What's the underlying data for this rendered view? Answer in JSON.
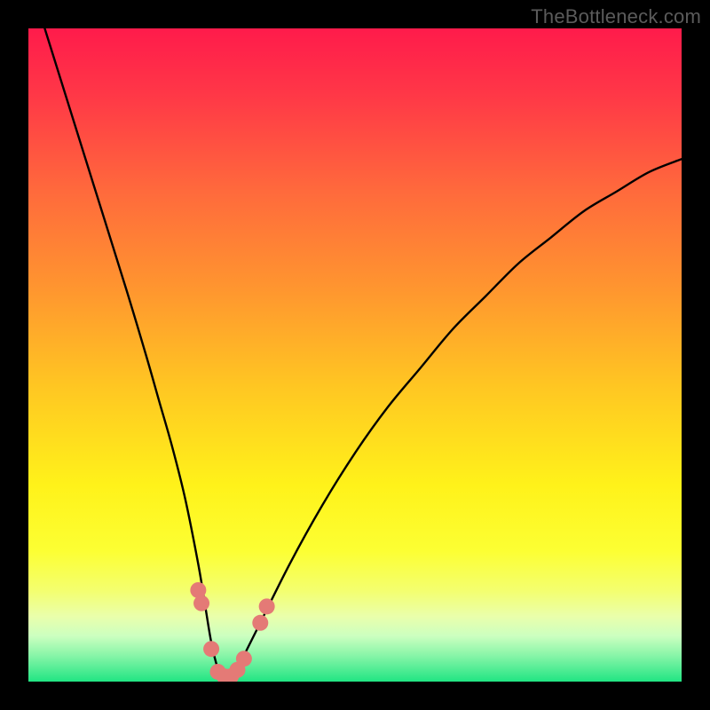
{
  "watermark": "TheBottleneck.com",
  "chart_data": {
    "type": "line",
    "title": "",
    "xlabel": "",
    "ylabel": "",
    "xlim": [
      0,
      100
    ],
    "ylim": [
      0,
      100
    ],
    "grid": false,
    "series": [
      {
        "name": "bottleneck-curve",
        "x": [
          0,
          5,
          10,
          15,
          18,
          20,
          22,
          24,
          26,
          27,
          28,
          29,
          30,
          31,
          32,
          33,
          35,
          40,
          45,
          50,
          55,
          60,
          65,
          70,
          75,
          80,
          85,
          90,
          95,
          100
        ],
        "values": [
          108,
          92,
          76,
          60,
          50,
          43,
          36,
          28,
          18,
          12,
          6,
          2,
          0,
          0,
          2,
          4,
          8,
          18,
          27,
          35,
          42,
          48,
          54,
          59,
          64,
          68,
          72,
          75,
          78,
          80
        ]
      }
    ],
    "annotations": [
      {
        "name": "dot-left-upper",
        "x": 26.0,
        "y": 14.0
      },
      {
        "name": "dot-left-mid",
        "x": 26.5,
        "y": 12.0
      },
      {
        "name": "dot-left-lower",
        "x": 28.0,
        "y": 5.0
      },
      {
        "name": "dot-valley-1",
        "x": 29.0,
        "y": 1.5
      },
      {
        "name": "dot-valley-2",
        "x": 30.0,
        "y": 0.8
      },
      {
        "name": "dot-valley-3",
        "x": 31.0,
        "y": 0.8
      },
      {
        "name": "dot-valley-4",
        "x": 32.0,
        "y": 1.8
      },
      {
        "name": "dot-right-lower",
        "x": 33.0,
        "y": 3.5
      },
      {
        "name": "dot-right-mid",
        "x": 35.5,
        "y": 9.0
      },
      {
        "name": "dot-right-upper",
        "x": 36.5,
        "y": 11.5
      }
    ],
    "gradient_bg": {
      "stops": [
        {
          "offset": 0.0,
          "color": "#ff1b4b"
        },
        {
          "offset": 0.1,
          "color": "#ff3747"
        },
        {
          "offset": 0.25,
          "color": "#ff6a3c"
        },
        {
          "offset": 0.4,
          "color": "#ff962f"
        },
        {
          "offset": 0.55,
          "color": "#ffc722"
        },
        {
          "offset": 0.7,
          "color": "#fff21a"
        },
        {
          "offset": 0.8,
          "color": "#fcff33"
        },
        {
          "offset": 0.86,
          "color": "#f4ff6e"
        },
        {
          "offset": 0.9,
          "color": "#eaffab"
        },
        {
          "offset": 0.93,
          "color": "#ccffc0"
        },
        {
          "offset": 0.96,
          "color": "#88f5a8"
        },
        {
          "offset": 1.0,
          "color": "#21e583"
        }
      ]
    },
    "colors": {
      "curve": "#000000",
      "dots": "#e47a76",
      "frame": "#000000"
    }
  }
}
